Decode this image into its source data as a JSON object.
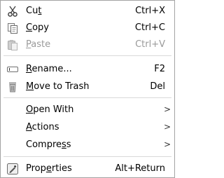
{
  "menu": {
    "items": [
      {
        "id": "cut",
        "pre": "Cu",
        "ul": "t",
        "post": "",
        "shortcut": "Ctrl+X",
        "icon": "scissors-icon",
        "enabled": true
      },
      {
        "id": "copy",
        "pre": "",
        "ul": "C",
        "post": "opy",
        "shortcut": "Ctrl+C",
        "icon": "copy-icon",
        "enabled": true
      },
      {
        "id": "paste",
        "pre": "",
        "ul": "P",
        "post": "aste",
        "shortcut": "Ctrl+V",
        "icon": "paste-icon",
        "enabled": false
      },
      {
        "id": "rename",
        "pre": "",
        "ul": "R",
        "post": "ename...",
        "shortcut": "F2",
        "icon": "rename-icon",
        "enabled": true
      },
      {
        "id": "trash",
        "pre": "",
        "ul": "M",
        "post": "ove to Trash",
        "shortcut": "Del",
        "icon": "trash-icon",
        "enabled": true
      },
      {
        "id": "open-with",
        "pre": "",
        "ul": "O",
        "post": "pen With",
        "shortcut": "",
        "submenu": true,
        "enabled": true
      },
      {
        "id": "actions",
        "pre": "",
        "ul": "A",
        "post": "ctions",
        "shortcut": "",
        "submenu": true,
        "enabled": true
      },
      {
        "id": "compress",
        "pre": "Compre",
        "ul": "s",
        "post": "s",
        "shortcut": "",
        "submenu": true,
        "enabled": true
      },
      {
        "id": "properties",
        "pre": "Prop",
        "ul": "e",
        "post": "rties",
        "shortcut": "Alt+Return",
        "icon": "properties-icon",
        "enabled": true
      }
    ],
    "submenu_arrow": ">"
  }
}
